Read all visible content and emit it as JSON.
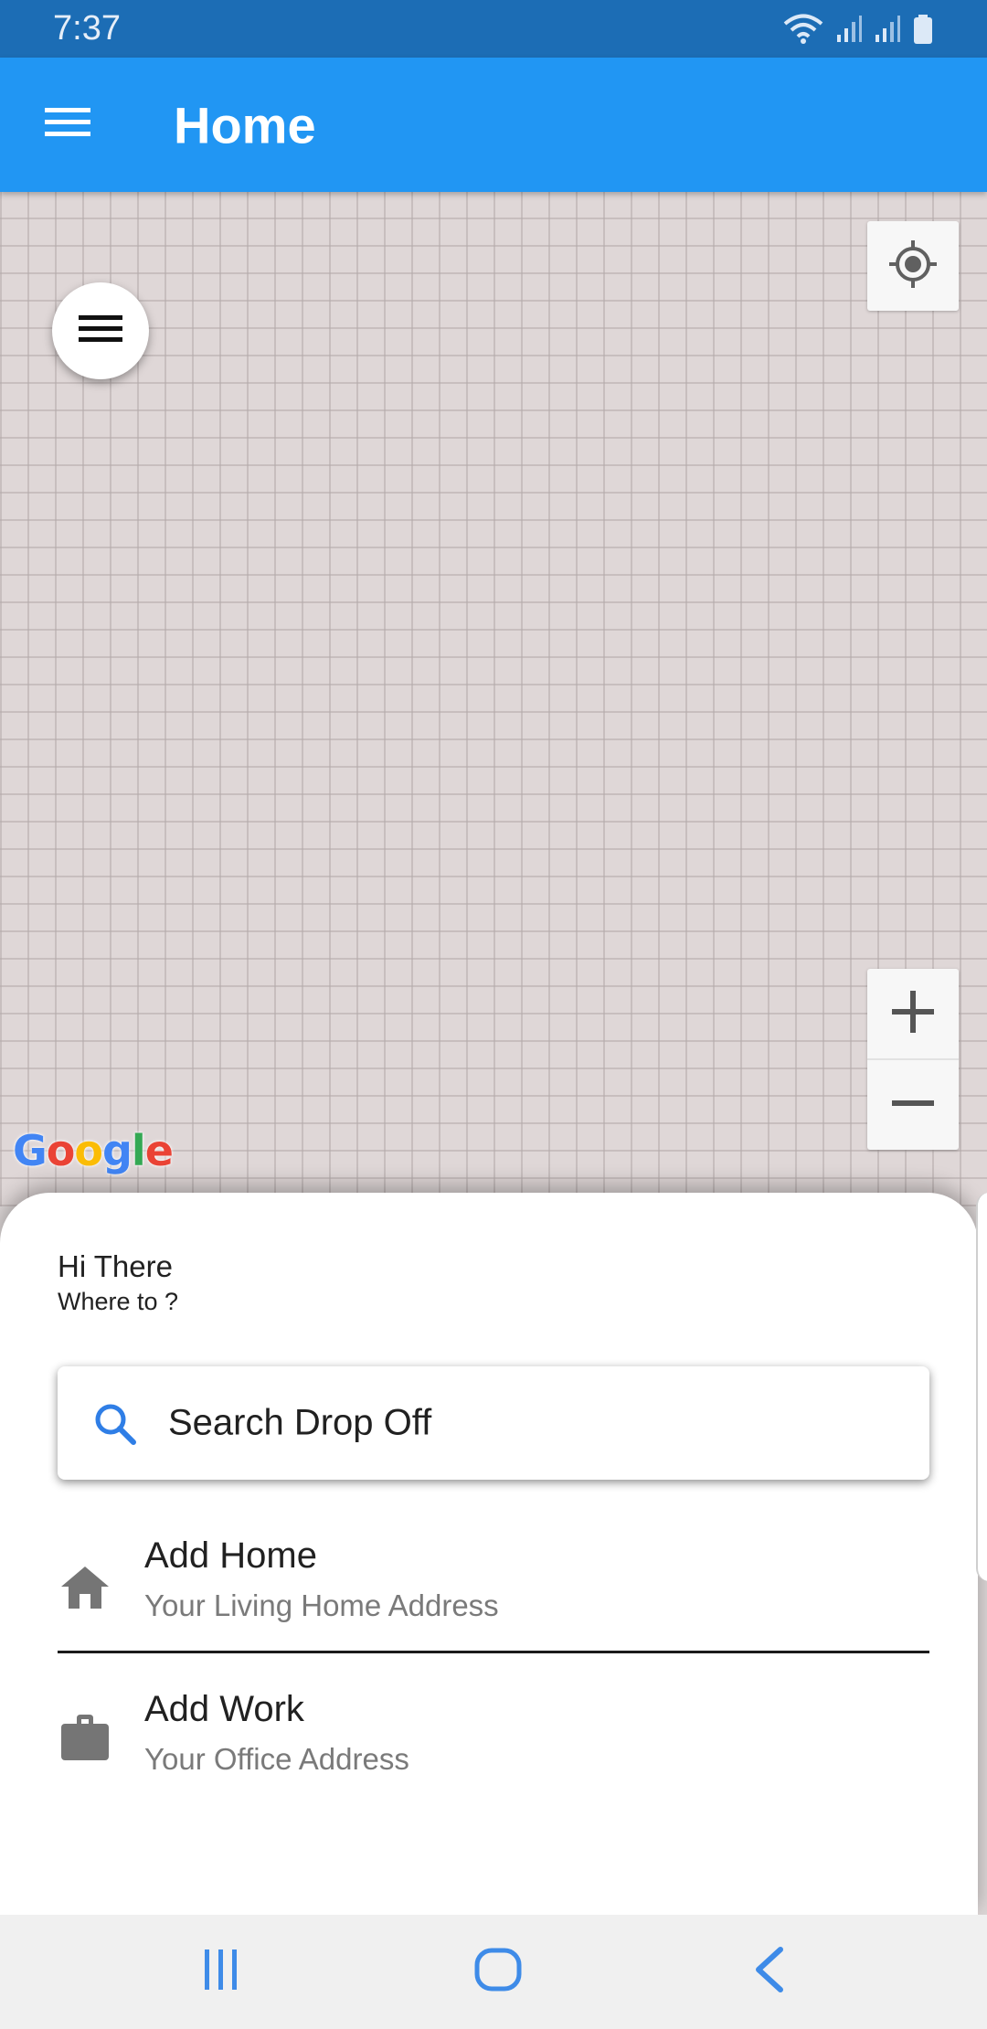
{
  "status_bar": {
    "time": "7:37",
    "icons": [
      "wifi-icon",
      "signal-icon",
      "signal-icon",
      "battery-icon"
    ]
  },
  "app_bar": {
    "title": "Home",
    "menu_icon": "hamburger-menu-icon",
    "background_color": "#2196f3"
  },
  "map": {
    "attribution": "Google",
    "controls": {
      "locate_icon": "my-location-icon",
      "zoom_in_icon": "plus-icon",
      "zoom_out_icon": "minus-icon",
      "drawer_icon": "hamburger-menu-icon"
    }
  },
  "sheet": {
    "greeting": "Hi There",
    "subgreeting": "Where to ?",
    "search": {
      "label": "Search Drop Off",
      "icon": "search-icon"
    },
    "places": [
      {
        "icon": "home-icon",
        "title": "Add Home",
        "subtitle": "Your Living Home Address"
      },
      {
        "icon": "briefcase-icon",
        "title": "Add Work",
        "subtitle": "Your Office Address"
      }
    ]
  },
  "nav_bar": {
    "buttons": [
      "recents-icon",
      "home-button-icon",
      "back-icon"
    ]
  }
}
